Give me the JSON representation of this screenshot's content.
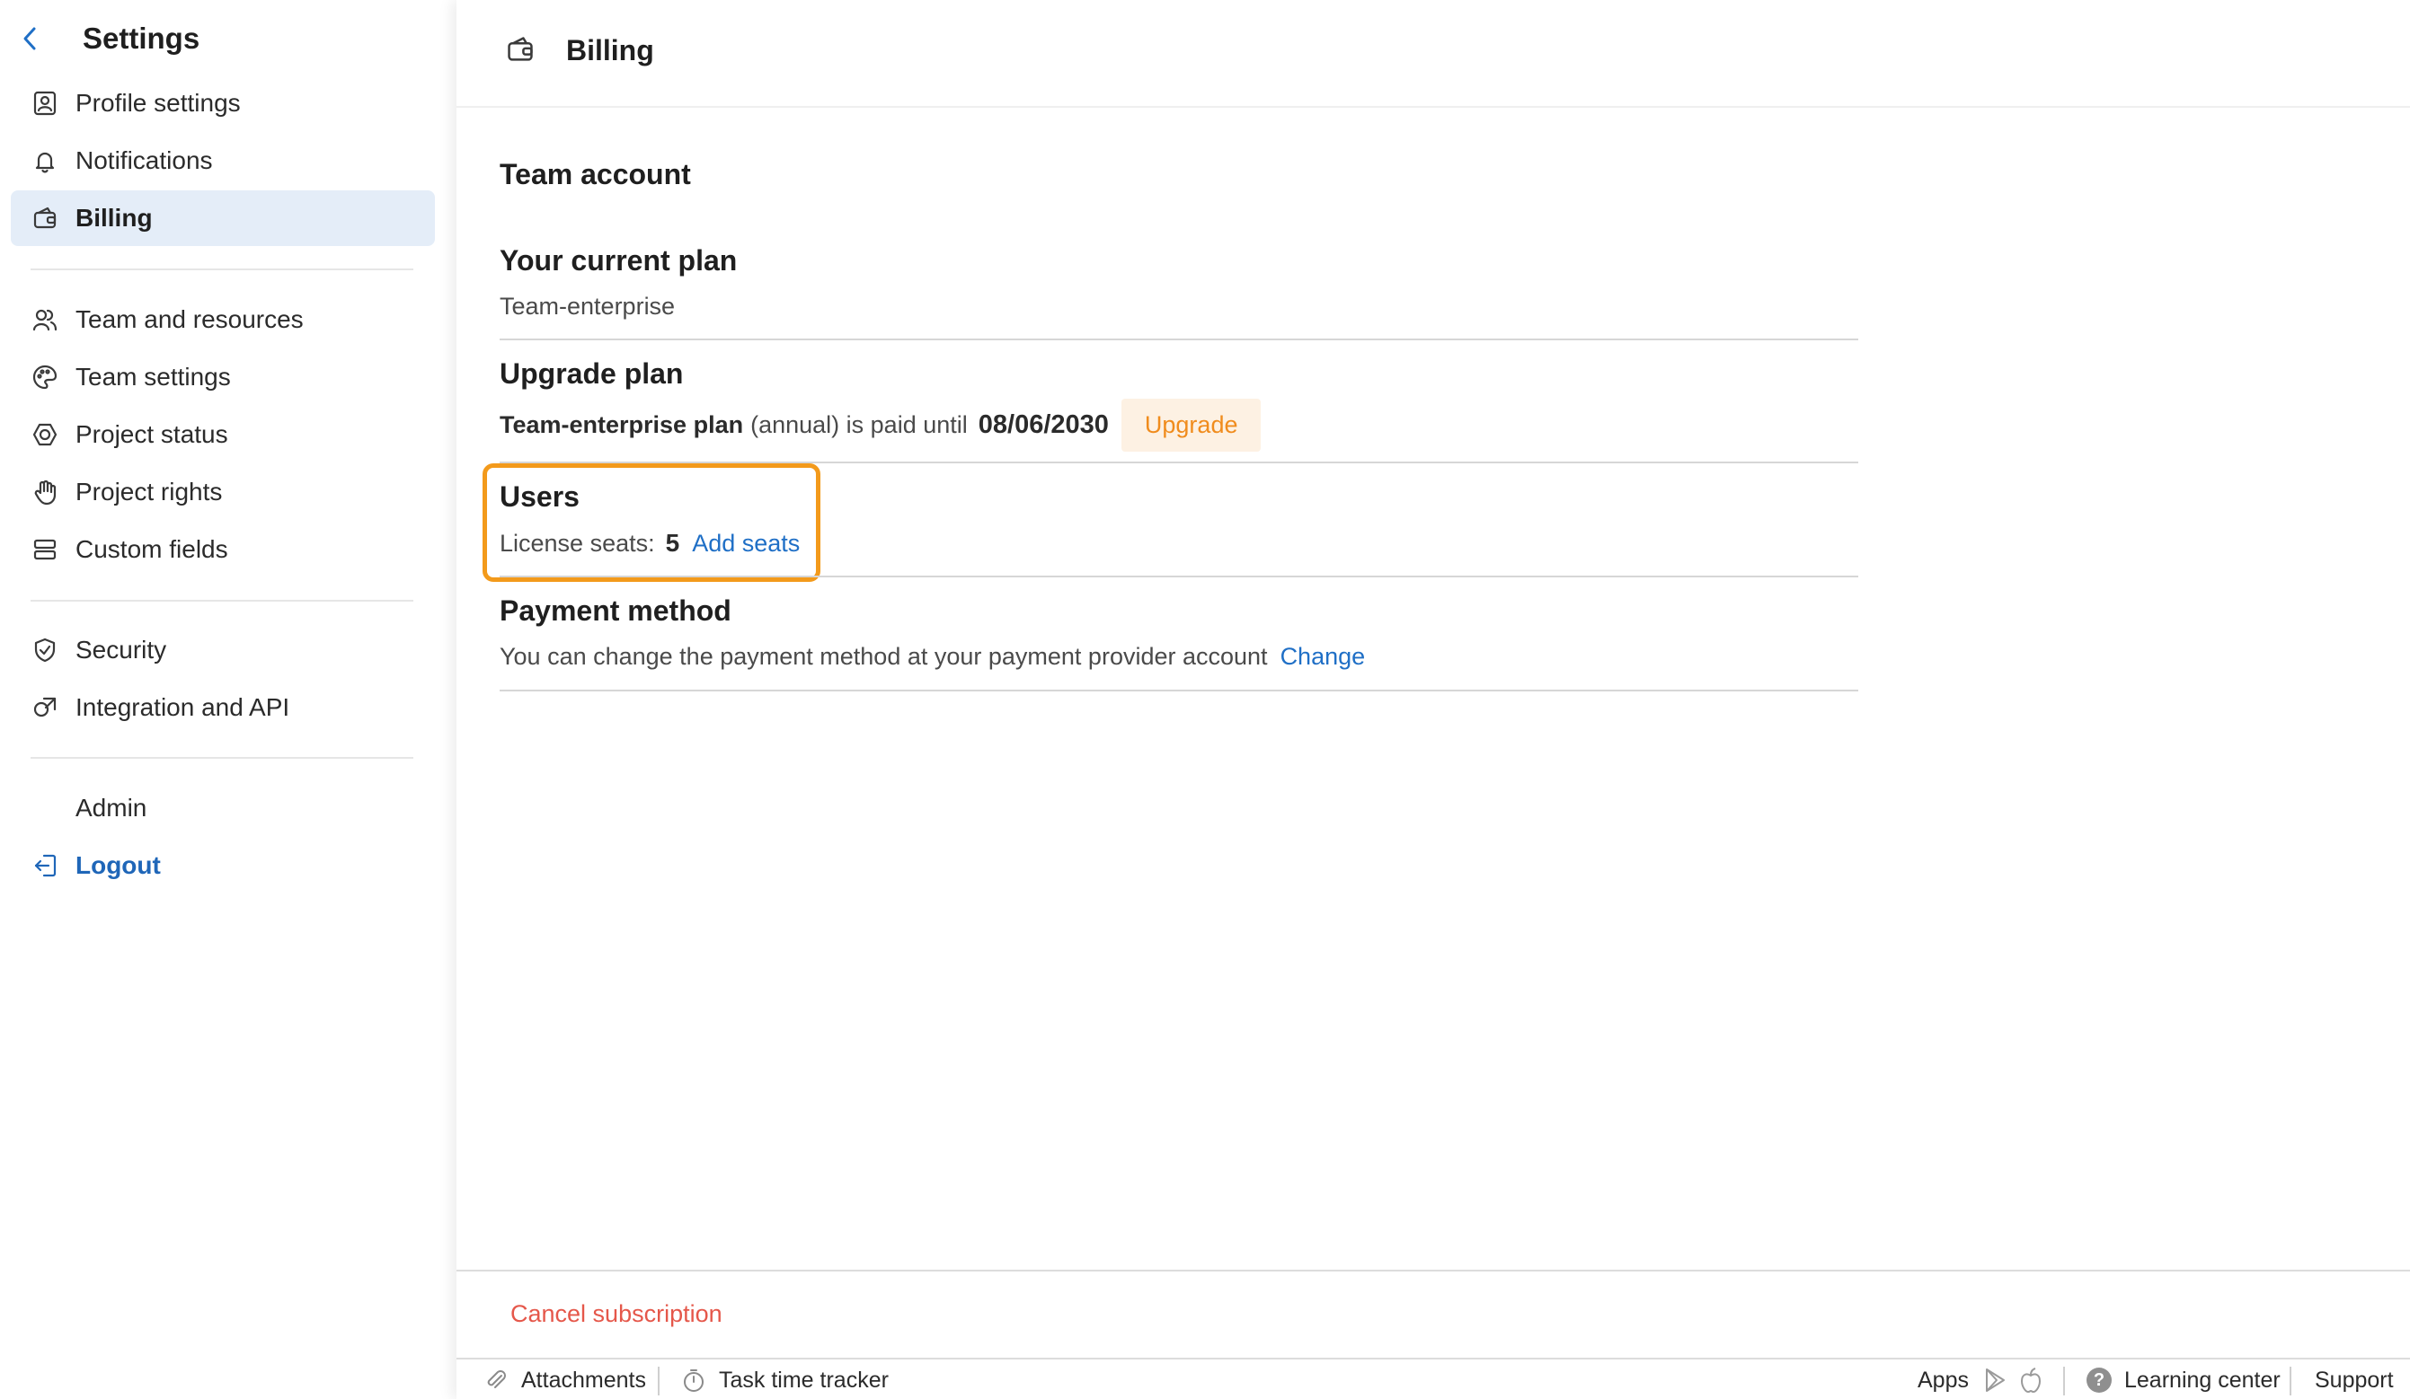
{
  "sidebar": {
    "title": "Settings",
    "items": [
      {
        "label": "Profile settings",
        "icon": "profile-icon"
      },
      {
        "label": "Notifications",
        "icon": "bell-icon"
      },
      {
        "label": "Billing",
        "icon": "wallet-icon",
        "active": true
      },
      {
        "label": "Team and resources",
        "icon": "users-icon"
      },
      {
        "label": "Team settings",
        "icon": "palette-icon"
      },
      {
        "label": "Project status",
        "icon": "status-icon"
      },
      {
        "label": "Project rights",
        "icon": "hand-icon"
      },
      {
        "label": "Custom fields",
        "icon": "fields-icon"
      },
      {
        "label": "Security",
        "icon": "shield-icon"
      },
      {
        "label": "Integration and API",
        "icon": "integration-icon"
      },
      {
        "label": "Admin",
        "icon": ""
      },
      {
        "label": "Logout",
        "icon": "logout-icon"
      }
    ]
  },
  "main": {
    "header_title": "Billing",
    "account_title": "Team account",
    "current_plan": {
      "title": "Your current plan",
      "value": "Team-enterprise"
    },
    "upgrade_plan": {
      "title": "Upgrade plan",
      "plan_name": "Team-enterprise plan",
      "plan_suffix": "(annual) is paid until",
      "date": "08/06/2030",
      "button": "Upgrade"
    },
    "users": {
      "title": "Users",
      "seats_label": "License seats:",
      "seats_value": "5",
      "add_link": "Add seats"
    },
    "payment": {
      "title": "Payment method",
      "text": "You can change the payment method at your payment provider account",
      "change_link": "Change"
    },
    "cancel": "Cancel subscription"
  },
  "bottombar": {
    "attachments": "Attachments",
    "time_tracker": "Task time tracker",
    "apps": "Apps",
    "learning": "Learning center",
    "support": "Support"
  },
  "colors": {
    "accent": "#1f6fc6",
    "highlight": "#f39a1b",
    "upgrade": "#f08c1d",
    "cancel": "#e5574a",
    "active_bg": "#e4edf8"
  }
}
